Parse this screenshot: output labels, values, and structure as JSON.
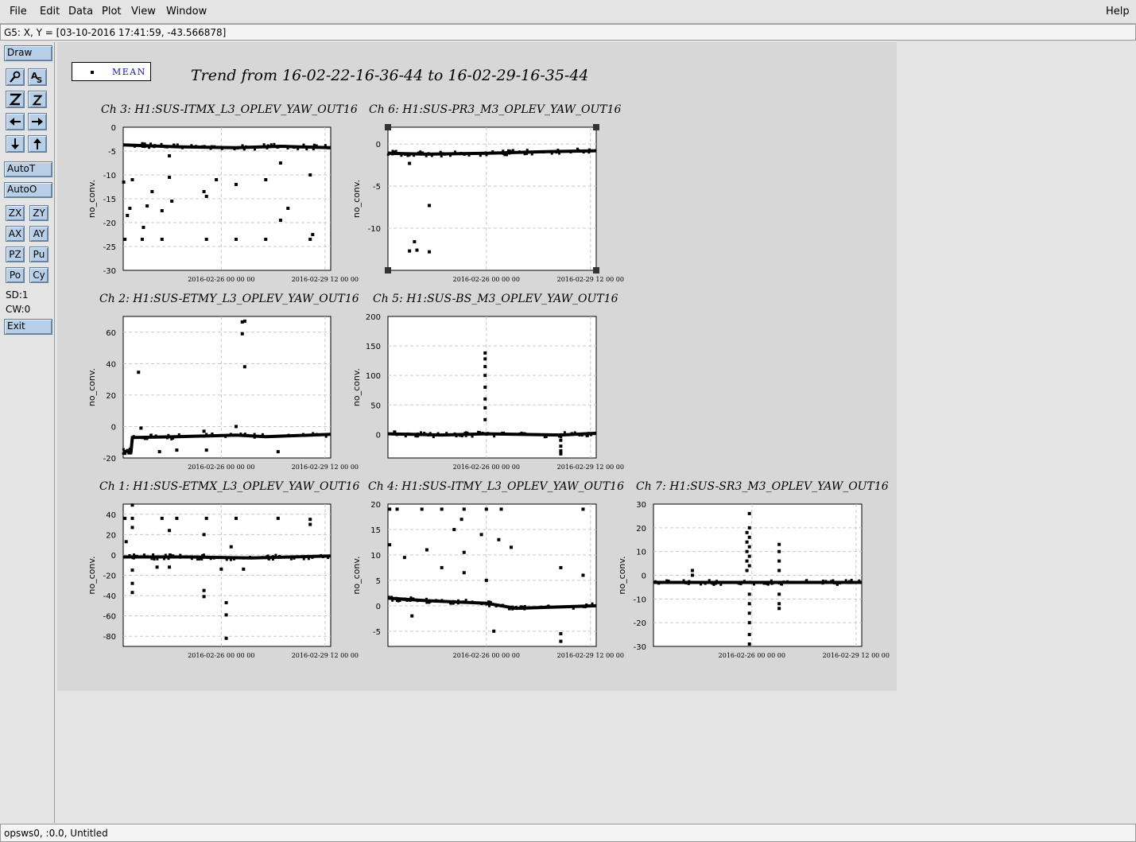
{
  "menu": {
    "file": "File",
    "edit": "Edit",
    "data": "Data",
    "plot": "Plot",
    "view": "View",
    "window": "Window",
    "help": "Help"
  },
  "coord_readout": "G5: X, Y = [03-10-2016 17:41:59, -43.566878]",
  "toolbar": {
    "draw": "Draw",
    "autot": "AutoT",
    "autoo": "AutoO",
    "zx": "ZX",
    "zy": "ZY",
    "ax": "AX",
    "ay": "AY",
    "pz": "PZ",
    "pu": "Pu",
    "po": "Po",
    "cy": "Cy",
    "sd": "SD:1",
    "cw": "CW:0",
    "exit": "Exit"
  },
  "icons": [
    "zoom-glass-icon",
    "autoscale-icon",
    "zoom-in-icon",
    "zoom-out-icon",
    "arrow-left-icon",
    "arrow-right-icon",
    "arrow-down-icon",
    "arrow-up-icon"
  ],
  "legend": {
    "label": "MEAN"
  },
  "main_title": "Trend from 16-02-22-16-36-44 to 16-02-29-16-35-44",
  "status_bar": "opsws0, :0.0, Untitled",
  "chart_data": [
    {
      "type": "scatter",
      "title": "Ch 3: H1:SUS-ITMX_L3_OPLEV_YAW_OUT16",
      "ylabel": "no_conv.",
      "xlabel": "",
      "xlim": [
        "2016-02-22 16:36:44",
        "2016-02-29 16:35:44"
      ],
      "ylim": [
        -30,
        0
      ],
      "yticks": [
        0,
        -5,
        -10,
        -15,
        -20,
        -25,
        -30
      ],
      "xticks": [
        "2016-02-26 00:00:00",
        "2016-02-29 12:00:00"
      ],
      "x_tick_labels": [
        "2016-02-26 00 00 00",
        "2016-02-29 12 00 00"
      ],
      "baseline": [
        [
          "2016-02-22 16:36:44",
          -3.7
        ],
        [
          "2016-02-24 12:00:00",
          -4.1
        ],
        [
          "2016-02-26 12:00:00",
          -4.3
        ],
        [
          "2016-02-28 00:00:00",
          -4.0
        ],
        [
          "2016-02-29 16:35:44",
          -4.3
        ]
      ],
      "points": [
        [
          "2016-02-22 17:00:00",
          -11.5
        ],
        [
          "2016-02-22 20:00:00",
          -18.5
        ],
        [
          "2016-02-22 22:00:00",
          -17.0
        ],
        [
          "2016-02-23 00:00:00",
          -11.0
        ],
        [
          "2016-02-23 09:00:00",
          -21.0
        ],
        [
          "2016-02-23 12:00:00",
          -16.5
        ],
        [
          "2016-02-23 16:00:00",
          -13.5
        ],
        [
          "2016-02-24 00:00:00",
          -17.5
        ],
        [
          "2016-02-24 06:00:00",
          -10.5
        ],
        [
          "2016-02-24 08:00:00",
          -15.5
        ],
        [
          "2016-02-25 10:00:00",
          -13.5
        ],
        [
          "2016-02-25 12:00:00",
          -14.5
        ],
        [
          "2016-02-25 20:00:00",
          -11.0
        ],
        [
          "2016-02-26 12:00:00",
          -12.0
        ],
        [
          "2016-02-27 12:00:00",
          -11.0
        ],
        [
          "2016-02-28 00:00:00",
          -7.5
        ],
        [
          "2016-02-28 06:00:00",
          -17.0
        ],
        [
          "2016-02-29 00:00:00",
          -10.0
        ],
        [
          "2016-02-29 02:00:00",
          -22.5
        ],
        [
          "2016-02-24 06:00:00",
          -6.0
        ],
        [
          "2016-02-22 18:00:00",
          -23.5
        ],
        [
          "2016-02-23 08:00:00",
          -23.5
        ],
        [
          "2016-02-24 00:00:00",
          -23.5
        ],
        [
          "2016-02-25 12:00:00",
          -23.5
        ],
        [
          "2016-02-26 12:00:00",
          -23.5
        ],
        [
          "2016-02-27 12:00:00",
          -23.5
        ],
        [
          "2016-02-29 00:00:00",
          -23.5
        ],
        [
          "2016-02-28 00:00:00",
          -19.5
        ]
      ]
    },
    {
      "type": "scatter",
      "title": "Ch 6: H1:SUS-PR3_M3_OPLEV_YAW_OUT16",
      "ylabel": "no_conv.",
      "xlabel": "",
      "xlim": [
        "2016-02-22 16:36:44",
        "2016-02-29 16:35:44"
      ],
      "ylim": [
        -15,
        2
      ],
      "yticks": [
        0,
        -5,
        -10
      ],
      "xticks": [
        "2016-02-26 00:00:00",
        "2016-02-29 12:00:00"
      ],
      "x_tick_labels": [
        "2016-02-26 00 00 00",
        "2016-02-29 12 00 00"
      ],
      "baseline": [
        [
          "2016-02-22 16:36:44",
          -1.1
        ],
        [
          "2016-02-24 00:00:00",
          -1.2
        ],
        [
          "2016-02-26 00:00:00",
          -1.1
        ],
        [
          "2016-02-28 00:00:00",
          -0.9
        ],
        [
          "2016-02-29 16:35:44",
          -0.8
        ]
      ],
      "points": [
        [
          "2016-02-23 10:00:00",
          -2.3
        ],
        [
          "2016-02-23 10:00:00",
          -12.7
        ],
        [
          "2016-02-23 14:00:00",
          -11.6
        ],
        [
          "2016-02-23 16:00:00",
          -12.6
        ],
        [
          "2016-02-24 02:00:00",
          -7.3
        ],
        [
          "2016-02-24 02:00:00",
          -12.8
        ]
      ]
    },
    {
      "type": "scatter",
      "title": "Ch 2: H1:SUS-ETMY_L3_OPLEV_YAW_OUT16",
      "ylabel": "no_conv.",
      "xlabel": "",
      "xlim": [
        "2016-02-22 16:36:44",
        "2016-02-29 16:35:44"
      ],
      "ylim": [
        -20,
        70
      ],
      "yticks": [
        60,
        40,
        20,
        0,
        -20
      ],
      "xticks": [
        "2016-02-26 00:00:00",
        "2016-02-29 12:00:00"
      ],
      "x_tick_labels": [
        "2016-02-26 00 00 00",
        "2016-02-29 12 00 00"
      ],
      "baseline": [
        [
          "2016-02-22 16:36:44",
          -16.0
        ],
        [
          "2016-02-22 23:00:00",
          -15.5
        ],
        [
          "2016-02-23 00:00:00",
          -7.0
        ],
        [
          "2016-02-24 12:00:00",
          -6.5
        ],
        [
          "2016-02-26 12:00:00",
          -5.5
        ],
        [
          "2016-02-27 12:00:00",
          -6.5
        ],
        [
          "2016-02-29 16:35:44",
          -5.0
        ]
      ],
      "points": [
        [
          "2016-02-23 05:00:00",
          34.5
        ],
        [
          "2016-02-23 07:00:00",
          -1.0
        ],
        [
          "2016-02-26 17:00:00",
          66.5
        ],
        [
          "2016-02-26 19:00:00",
          67.0
        ],
        [
          "2016-02-26 17:00:00",
          59.0
        ],
        [
          "2016-02-26 19:00:00",
          38.0
        ],
        [
          "2016-02-26 12:00:00",
          0.0
        ],
        [
          "2016-02-23 22:00:00",
          -16.0
        ],
        [
          "2016-02-24 12:00:00",
          -15.0
        ],
        [
          "2016-02-25 12:00:00",
          -15.0
        ],
        [
          "2016-02-27 22:00:00",
          -16.0
        ],
        [
          "2016-02-25 10:00:00",
          -3.0
        ]
      ]
    },
    {
      "type": "scatter",
      "title": "Ch 5: H1:SUS-BS_M3_OPLEV_YAW_OUT16",
      "ylabel": "no_conv.",
      "xlabel": "",
      "xlim": [
        "2016-02-22 16:36:44",
        "2016-02-29 16:35:44"
      ],
      "ylim": [
        -40,
        200
      ],
      "yticks": [
        200,
        150,
        100,
        50,
        0
      ],
      "xticks": [
        "2016-02-26 00:00:00",
        "2016-02-29 12:00:00"
      ],
      "x_tick_labels": [
        "2016-02-26 00 00 00",
        "2016-02-29 12 00 00"
      ],
      "baseline": [
        [
          "2016-02-22 16:36:44",
          1.0
        ],
        [
          "2016-02-24 12:00:00",
          -1.0
        ],
        [
          "2016-02-26 00:00:00",
          1.0
        ],
        [
          "2016-02-28 12:00:00",
          -1.0
        ],
        [
          "2016-02-29 16:35:44",
          2.0
        ]
      ],
      "points": [
        [
          "2016-02-25 23:00:00",
          138.0
        ],
        [
          "2016-02-25 23:00:00",
          128.0
        ],
        [
          "2016-02-25 23:00:00",
          115.0
        ],
        [
          "2016-02-25 23:00:00",
          100.0
        ],
        [
          "2016-02-25 23:00:00",
          80.0
        ],
        [
          "2016-02-25 23:00:00",
          60.0
        ],
        [
          "2016-02-25 23:00:00",
          45.0
        ],
        [
          "2016-02-25 23:00:00",
          25.0
        ],
        [
          "2016-02-28 12:00:00",
          -10.0
        ],
        [
          "2016-02-28 12:00:00",
          -20.0
        ],
        [
          "2016-02-28 12:00:00",
          -28.0
        ],
        [
          "2016-02-28 12:00:00",
          -33.0
        ],
        [
          "2016-02-22 22:00:00",
          4.0
        ]
      ]
    },
    {
      "type": "scatter",
      "title": "Ch 1: H1:SUS-ETMX_L3_OPLEV_YAW_OUT16",
      "ylabel": "no_conv.",
      "xlabel": "",
      "xlim": [
        "2016-02-22 16:36:44",
        "2016-02-29 16:35:44"
      ],
      "ylim": [
        -90,
        50
      ],
      "yticks": [
        40,
        20,
        0,
        -20,
        -40,
        -60,
        -80
      ],
      "xticks": [
        "2016-02-26 00:00:00",
        "2016-02-29 12:00:00"
      ],
      "x_tick_labels": [
        "2016-02-26 00 00 00",
        "2016-02-29 12 00 00"
      ],
      "baseline": [
        [
          "2016-02-22 16:36:44",
          -2.0
        ],
        [
          "2016-02-25 00:00:00",
          -2.0
        ],
        [
          "2016-02-27 00:00:00",
          -3.0
        ],
        [
          "2016-02-29 16:35:44",
          -1.0
        ]
      ],
      "points": [
        [
          "2016-02-22 18:00:00",
          36.0
        ],
        [
          "2016-02-23 00:00:00",
          36.0
        ],
        [
          "2016-02-24 00:00:00",
          36.0
        ],
        [
          "2016-02-24 12:00:00",
          36.0
        ],
        [
          "2016-02-25 12:00:00",
          36.0
        ],
        [
          "2016-02-26 12:00:00",
          36.0
        ],
        [
          "2016-02-27 22:00:00",
          36.0
        ],
        [
          "2016-02-29 00:00:00",
          35.0
        ],
        [
          "2016-02-23 00:00:00",
          49.0
        ],
        [
          "2016-02-23 00:00:00",
          27.0
        ],
        [
          "2016-02-24 06:00:00",
          24.0
        ],
        [
          "2016-02-25 10:00:00",
          20.0
        ],
        [
          "2016-02-23 00:00:00",
          -15.0
        ],
        [
          "2016-02-23 00:00:00",
          -28.0
        ],
        [
          "2016-02-23 00:00:00",
          -37.0
        ],
        [
          "2016-02-23 20:00:00",
          -12.0
        ],
        [
          "2016-02-24 06:00:00",
          -12.0
        ],
        [
          "2016-02-25 10:00:00",
          -35.0
        ],
        [
          "2016-02-25 10:00:00",
          -41.0
        ],
        [
          "2016-02-26 00:00:00",
          -14.0
        ],
        [
          "2016-02-26 04:00:00",
          -47.0
        ],
        [
          "2016-02-26 04:00:00",
          -59.0
        ],
        [
          "2016-02-26 04:00:00",
          -82.0
        ],
        [
          "2016-02-26 18:00:00",
          -14.0
        ],
        [
          "2016-02-22 19:00:00",
          13.0
        ],
        [
          "2016-02-26 08:00:00",
          8.0
        ],
        [
          "2016-02-29 00:00:00",
          30.0
        ]
      ]
    },
    {
      "type": "scatter",
      "title": "Ch 4: H1:SUS-ITMY_L3_OPLEV_YAW_OUT16",
      "ylabel": "no_conv.",
      "xlabel": "",
      "xlim": [
        "2016-02-22 16:36:44",
        "2016-02-29 16:35:44"
      ],
      "ylim": [
        -8,
        20
      ],
      "yticks": [
        20,
        15,
        10,
        5,
        0,
        -5
      ],
      "xticks": [
        "2016-02-26 00:00:00",
        "2016-02-29 12:00:00"
      ],
      "x_tick_labels": [
        "2016-02-26 00 00 00",
        "2016-02-29 12 00 00"
      ],
      "baseline": [
        [
          "2016-02-22 16:36:44",
          1.5
        ],
        [
          "2016-02-24 00:00:00",
          1.0
        ],
        [
          "2016-02-26 00:00:00",
          0.5
        ],
        [
          "2016-02-27 00:00:00",
          -0.5
        ],
        [
          "2016-02-29 16:35:44",
          0.0
        ]
      ],
      "points": [
        [
          "2016-02-22 18:00:00",
          19.0
        ],
        [
          "2016-02-23 00:00:00",
          19.0
        ],
        [
          "2016-02-23 20:00:00",
          19.0
        ],
        [
          "2016-02-24 12:00:00",
          19.0
        ],
        [
          "2016-02-25 06:00:00",
          19.0
        ],
        [
          "2016-02-26 00:00:00",
          19.0
        ],
        [
          "2016-02-26 12:00:00",
          19.0
        ],
        [
          "2016-02-29 06:00:00",
          19.0
        ],
        [
          "2016-02-22 18:00:00",
          12.0
        ],
        [
          "2016-02-23 06:00:00",
          9.5
        ],
        [
          "2016-02-24 00:00:00",
          11.0
        ],
        [
          "2016-02-24 22:00:00",
          15.0
        ],
        [
          "2016-02-25 04:00:00",
          17.0
        ],
        [
          "2016-02-25 06:00:00",
          10.5
        ],
        [
          "2016-02-25 20:00:00",
          14.0
        ],
        [
          "2016-02-26 10:00:00",
          13.0
        ],
        [
          "2016-02-26 20:00:00",
          11.5
        ],
        [
          "2016-02-24 12:00:00",
          7.5
        ],
        [
          "2016-02-25 06:00:00",
          6.5
        ],
        [
          "2016-02-26 00:00:00",
          5.0
        ],
        [
          "2016-02-28 12:00:00",
          7.5
        ],
        [
          "2016-02-28 12:00:00",
          -5.5
        ],
        [
          "2016-02-28 12:00:00",
          -7.0
        ],
        [
          "2016-02-26 06:00:00",
          -5.0
        ],
        [
          "2016-02-29 06:00:00",
          6.0
        ],
        [
          "2016-02-23 12:00:00",
          -2.0
        ]
      ]
    },
    {
      "type": "scatter",
      "title": "Ch 7: H1:SUS-SR3_M3_OPLEV_YAW_OUT16",
      "ylabel": "no_conv.",
      "xlabel": "",
      "xlim": [
        "2016-02-22 16:36:44",
        "2016-02-29 16:35:44"
      ],
      "ylim": [
        -30,
        30
      ],
      "yticks": [
        30,
        20,
        10,
        0,
        -10,
        -20,
        -30
      ],
      "xticks": [
        "2016-02-26 00:00:00",
        "2016-02-29 12:00:00"
      ],
      "x_tick_labels": [
        "2016-02-26 00 00 00",
        "2016-02-29 12 00 00"
      ],
      "baseline": [
        [
          "2016-02-22 16:36:44",
          -3.0
        ],
        [
          "2016-02-25 00:00:00",
          -3.0
        ],
        [
          "2016-02-27 00:00:00",
          -3.0
        ],
        [
          "2016-02-29 16:35:44",
          -3.0
        ]
      ],
      "points": [
        [
          "2016-02-24 00:00:00",
          2.0
        ],
        [
          "2016-02-24 00:00:00",
          0.0
        ],
        [
          "2016-02-25 20:00:00",
          18.0
        ],
        [
          "2016-02-25 20:00:00",
          14.0
        ],
        [
          "2016-02-25 20:00:00",
          10.0
        ],
        [
          "2016-02-25 20:00:00",
          6.0
        ],
        [
          "2016-02-25 20:00:00",
          2.0
        ],
        [
          "2016-02-25 22:00:00",
          26.0
        ],
        [
          "2016-02-25 22:00:00",
          20.0
        ],
        [
          "2016-02-25 22:00:00",
          16.0
        ],
        [
          "2016-02-25 22:00:00",
          12.0
        ],
        [
          "2016-02-25 22:00:00",
          8.0
        ],
        [
          "2016-02-25 22:00:00",
          4.0
        ],
        [
          "2016-02-25 22:00:00",
          -8.0
        ],
        [
          "2016-02-25 22:00:00",
          -12.0
        ],
        [
          "2016-02-25 22:00:00",
          -16.0
        ],
        [
          "2016-02-25 22:00:00",
          -20.0
        ],
        [
          "2016-02-25 22:00:00",
          -25.0
        ],
        [
          "2016-02-25 22:00:00",
          -29.0
        ],
        [
          "2016-02-26 22:00:00",
          13.0
        ],
        [
          "2016-02-26 22:00:00",
          10.0
        ],
        [
          "2016-02-26 22:00:00",
          6.0
        ],
        [
          "2016-02-26 22:00:00",
          2.0
        ],
        [
          "2016-02-26 22:00:00",
          -8.0
        ],
        [
          "2016-02-26 22:00:00",
          -12.0
        ],
        [
          "2016-02-26 22:00:00",
          -14.0
        ]
      ]
    }
  ]
}
